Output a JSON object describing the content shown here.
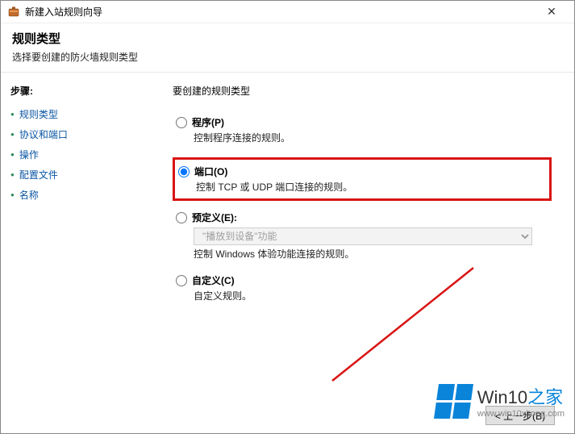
{
  "window": {
    "title": "新建入站规则向导"
  },
  "header": {
    "title": "规则类型",
    "subtitle": "选择要创建的防火墙规则类型"
  },
  "sidebar": {
    "steps_label": "步骤:",
    "items": [
      {
        "label": "规则类型"
      },
      {
        "label": "协议和端口"
      },
      {
        "label": "操作"
      },
      {
        "label": "配置文件"
      },
      {
        "label": "名称"
      }
    ]
  },
  "main": {
    "question": "要创建的规则类型",
    "options": {
      "program": {
        "label": "程序(P)",
        "desc": "控制程序连接的规则。"
      },
      "port": {
        "label": "端口(O)",
        "desc": "控制 TCP 或 UDP 端口连接的规则。"
      },
      "predefined": {
        "label": "预定义(E):",
        "select_value": "\"播放到设备\"功能",
        "desc": "控制 Windows 体验功能连接的规则。"
      },
      "custom": {
        "label": "自定义(C)",
        "desc": "自定义规则。"
      }
    }
  },
  "footer": {
    "back": "< 上一步(B)"
  },
  "watermark": {
    "text1_a": "Win10",
    "text1_b": "之家",
    "text2": "www.win10xitong.com"
  }
}
